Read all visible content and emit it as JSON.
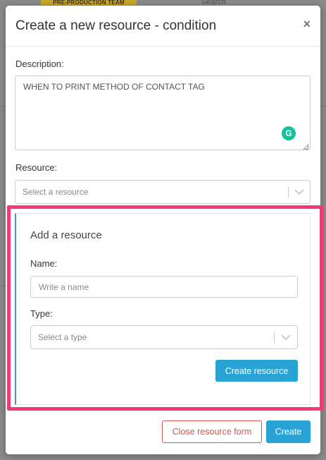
{
  "background": {
    "badge_text": "PRE-PRODUCTION TEAM",
    "search_text": "Search"
  },
  "modal": {
    "title": "Create a new resource - condition",
    "close_glyph": "×",
    "description_label": "Description:",
    "description_value": "WHEN TO PRINT METHOD OF CONTACT TAG",
    "grammarly_glyph": "G",
    "resource_label": "Resource:",
    "resource_placeholder": "Select a resource",
    "add_resource": {
      "title": "Add a resource",
      "name_label": "Name:",
      "name_placeholder": "Write a name",
      "type_label": "Type:",
      "type_placeholder": "Select a type",
      "create_resource_button": "Create resource"
    },
    "close_resource_form_button": "Close resource form",
    "create_button": "Create"
  },
  "colors": {
    "highlight": "#f23a78",
    "primary": "#29a3d6",
    "danger": "#d9534f",
    "grammarly": "#15c39a"
  }
}
